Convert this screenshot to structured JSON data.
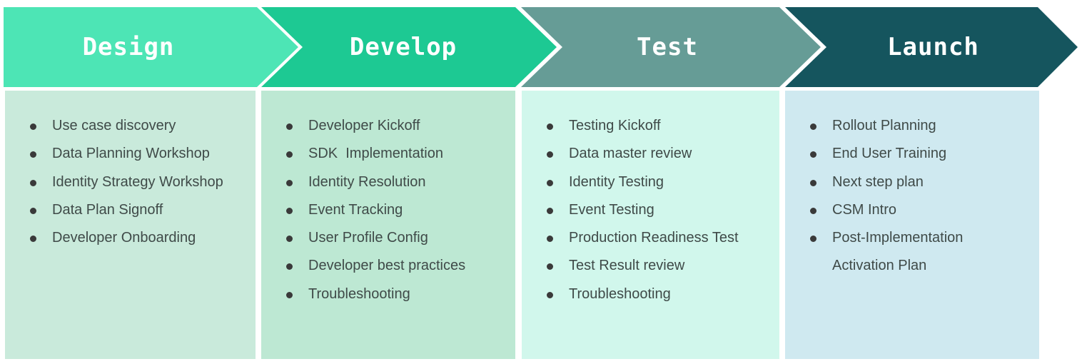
{
  "colors": {
    "design_arrow": "#4de5b5",
    "develop_arrow": "#1dc993",
    "test_arrow": "#669c96",
    "launch_arrow": "#15555e",
    "design_box": "#c9eadb",
    "develop_box": "#bde8d3",
    "test_box": "#d1f7ec",
    "launch_box": "#cfe9f0"
  },
  "stages": [
    {
      "title": "Design",
      "items": [
        "Use case discovery",
        "Data Planning Workshop",
        "Identity Strategy Workshop",
        "Data Plan Signoff",
        "Developer Onboarding"
      ]
    },
    {
      "title": "Develop",
      "items": [
        "Developer Kickoff",
        "SDK  Implementation",
        "Identity Resolution",
        "Event Tracking",
        "User Profile Config",
        "Developer best practices",
        "Troubleshooting"
      ]
    },
    {
      "title": "Test",
      "items": [
        "Testing Kickoff",
        "Data master review",
        "Identity Testing",
        "Event Testing",
        "Production Readiness Test",
        "Test Result review",
        "Troubleshooting"
      ]
    },
    {
      "title": "Launch",
      "items": [
        "Rollout Planning",
        "End User Training",
        "Next step plan",
        "CSM Intro",
        "Post-Implementation",
        "Activation Plan"
      ]
    }
  ]
}
